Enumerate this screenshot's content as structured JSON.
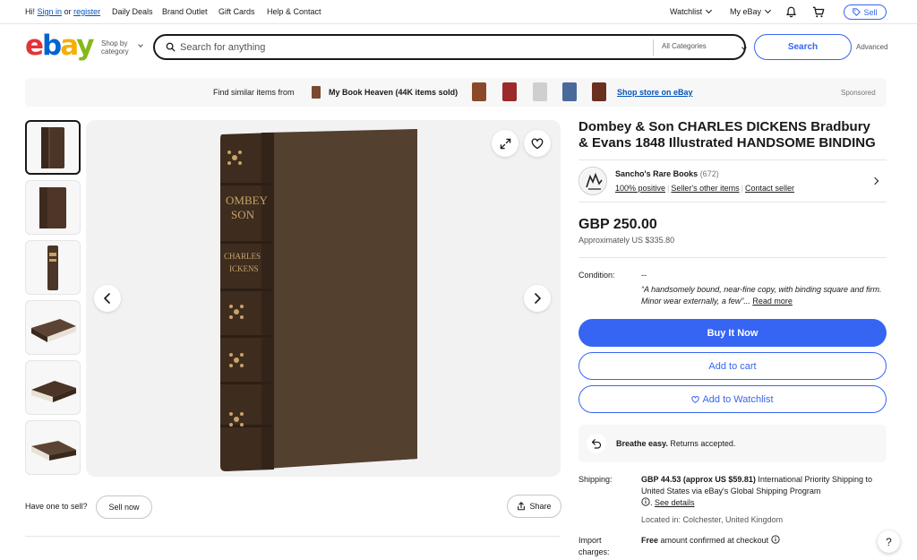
{
  "topbar": {
    "greeting": "Hi!",
    "sign_in": "Sign in",
    "or": "or",
    "register": "register",
    "daily_deals": "Daily Deals",
    "brand_outlet": "Brand Outlet",
    "gift_cards": "Gift Cards",
    "help_contact": "Help & Contact",
    "watchlist": "Watchlist",
    "my_ebay": "My eBay",
    "sell": "Sell"
  },
  "header": {
    "logo": [
      "e",
      "b",
      "a",
      "y"
    ],
    "shop_by_category": "Shop by category",
    "search_placeholder": "Search for anything",
    "category_select": "All Categories",
    "search_button": "Search",
    "advanced": "Advanced"
  },
  "banner": {
    "find_similar": "Find similar items from",
    "store_name": "My Book Heaven",
    "store_count": "(44K items sold)",
    "shop_store": "Shop store on eBay",
    "sponsored": "Sponsored",
    "thumb_colors": [
      "#8a4a2a",
      "#9c2a2a",
      "#cfcfcf",
      "#4a6a9a",
      "#6a3020"
    ]
  },
  "listing": {
    "title": "Dombey & Son CHARLES DICKENS Bradbury & Evans 1848 Illustrated HANDSOME BINDING",
    "seller": {
      "name": "Sancho's Rare Books",
      "feedback": "(672)",
      "positive": "100% positive",
      "other_items": "Seller's other items",
      "contact": "Contact seller"
    },
    "price": "GBP 250.00",
    "approx_label": "Approximately",
    "approx_value": "US $335.80",
    "condition_label": "Condition:",
    "condition_value": "--",
    "description": "“A handsomely bound, near-fine copy, with binding square and firm. Minor wear externally, a few”...",
    "read_more": "Read more",
    "buy_now": "Buy It Now",
    "add_to_cart": "Add to cart",
    "add_to_watchlist": "Add to Watchlist",
    "returns_bold": "Breathe easy.",
    "returns_text": "Returns accepted.",
    "shipping_label": "Shipping:",
    "shipping_bold": "GBP 44.53 (approx US $59.81)",
    "shipping_text": "International Priority Shipping to United States via eBay's Global Shipping Program",
    "see_details": "See details",
    "located": "Located in: Colchester, United Kingdom",
    "import_label": "Import charges:",
    "import_bold": "Free",
    "import_text": "amount confirmed at checkout"
  },
  "book": {
    "spine_line1": "OMBEY",
    "spine_line2": "SON",
    "spine_line3": "CHARLES",
    "spine_line4": "ICKENS"
  },
  "gallery": {
    "have_one": "Have one to sell?",
    "sell_now": "Sell now",
    "share": "Share"
  },
  "help": "?",
  "colors": {
    "brand_blue": "#3665f3",
    "link_blue": "#0654ba",
    "book_brown": "#4a3526"
  }
}
